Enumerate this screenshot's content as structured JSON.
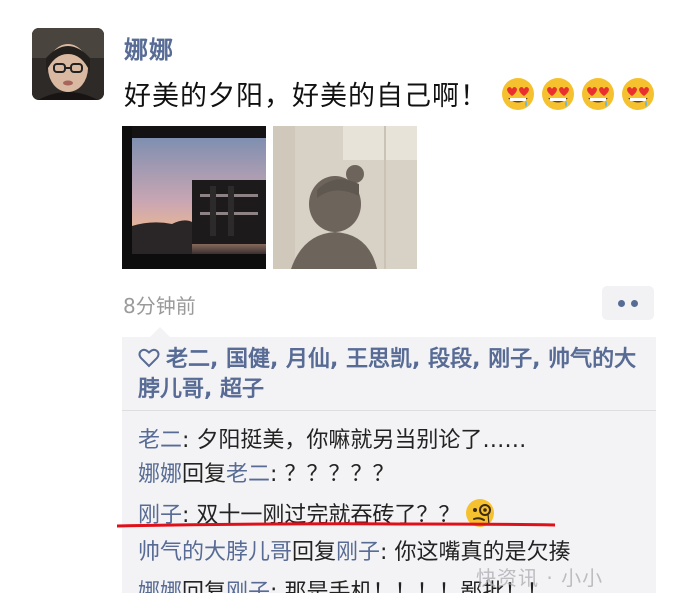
{
  "post": {
    "author": "娜娜",
    "text": "好美的夕阳，好美的自己啊！",
    "emoji_name": "drooling-heart-eyes-emoji",
    "emoji_count": 4,
    "time": "8分钟前"
  },
  "likes": {
    "names": "老二, 国健, 月仙, 王思凯, 段段, 刚子, 帅气的大脖儿哥, 超子"
  },
  "comments": [
    {
      "name": "老二",
      "reply_word": "",
      "reply_to": "",
      "text": ": 夕阳挺美，你嘛就另当别论了……"
    },
    {
      "name": "娜娜",
      "reply_word": "回复",
      "reply_to": "老二",
      "text": ": ？？？？？"
    },
    {
      "name": "刚子",
      "reply_word": "",
      "reply_to": "",
      "text": ": 双十一刚过完就吞砖了？？"
    },
    {
      "name": "帅气的大脖儿哥",
      "reply_word": "回复",
      "reply_to": "刚子",
      "text": ": 你这嘴真的是欠揍"
    },
    {
      "name": "娜娜",
      "reply_word": "回复",
      "reply_to": "刚子",
      "text": ": 那是手机！！！！鄙批！！"
    }
  ],
  "watermark": "快资讯 · 小小",
  "colors": {
    "link": "#576b95",
    "highlight_underline": "#e0101a",
    "comment_panel": "#f3f3f5"
  }
}
